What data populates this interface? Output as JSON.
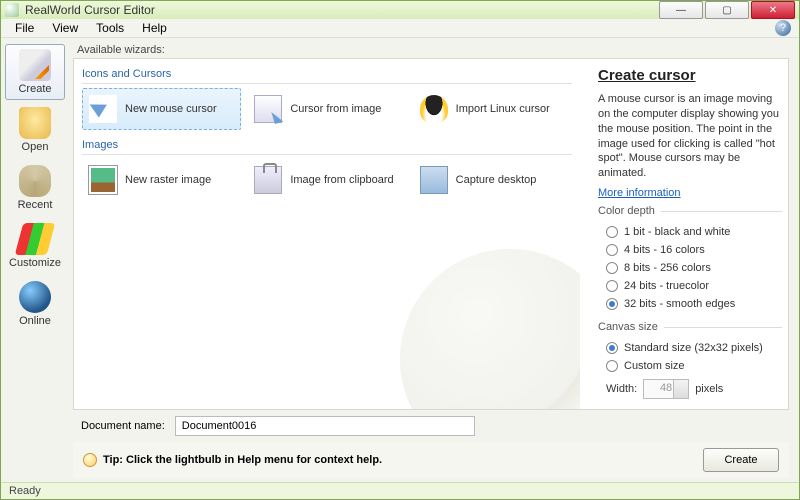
{
  "window": {
    "title": "RealWorld Cursor Editor"
  },
  "menu": {
    "items": [
      "File",
      "View",
      "Tools",
      "Help"
    ]
  },
  "leftnav": {
    "items": [
      {
        "label": "Create",
        "icon": "create",
        "active": true
      },
      {
        "label": "Open",
        "icon": "open"
      },
      {
        "label": "Recent",
        "icon": "recent"
      },
      {
        "label": "Customize",
        "icon": "customize"
      },
      {
        "label": "Online",
        "icon": "online"
      }
    ]
  },
  "wizardsLabel": "Available wizards:",
  "groups": {
    "cursors": {
      "header": "Icons and Cursors",
      "items": [
        {
          "label": "New mouse cursor",
          "icon": "cursor",
          "selected": true
        },
        {
          "label": "Cursor from image",
          "icon": "img"
        },
        {
          "label": "Import Linux cursor",
          "icon": "tux"
        }
      ]
    },
    "images": {
      "header": "Images",
      "items": [
        {
          "label": "New raster image",
          "icon": "raster"
        },
        {
          "label": "Image from clipboard",
          "icon": "clip"
        },
        {
          "label": "Capture desktop",
          "icon": "cap"
        }
      ]
    }
  },
  "details": {
    "title": "Create cursor",
    "desc": "A mouse cursor is an image moving on the computer display showing you the mouse position. The point in the image used for clicking is called \"hot spot\". Mouse cursors may be animated.",
    "moreInfo": "More information",
    "colorDepth": {
      "legend": "Color depth",
      "options": [
        "1 bit - black and white",
        "4 bits - 16 colors",
        "8 bits - 256 colors",
        "24 bits - truecolor",
        "32 bits - smooth edges"
      ],
      "selectedIndex": 4
    },
    "canvas": {
      "legend": "Canvas size",
      "standard": "Standard size (32x32 pixels)",
      "custom": "Custom size",
      "selected": "standard",
      "widthLabel": "Width:",
      "widthValue": "48",
      "widthUnit": "pixels"
    }
  },
  "doc": {
    "label": "Document name:",
    "value": "Document0016"
  },
  "tip": {
    "prefix": "Tip:",
    "text": "Click the lightbulb in Help menu for context help."
  },
  "createBtn": "Create",
  "status": "Ready"
}
